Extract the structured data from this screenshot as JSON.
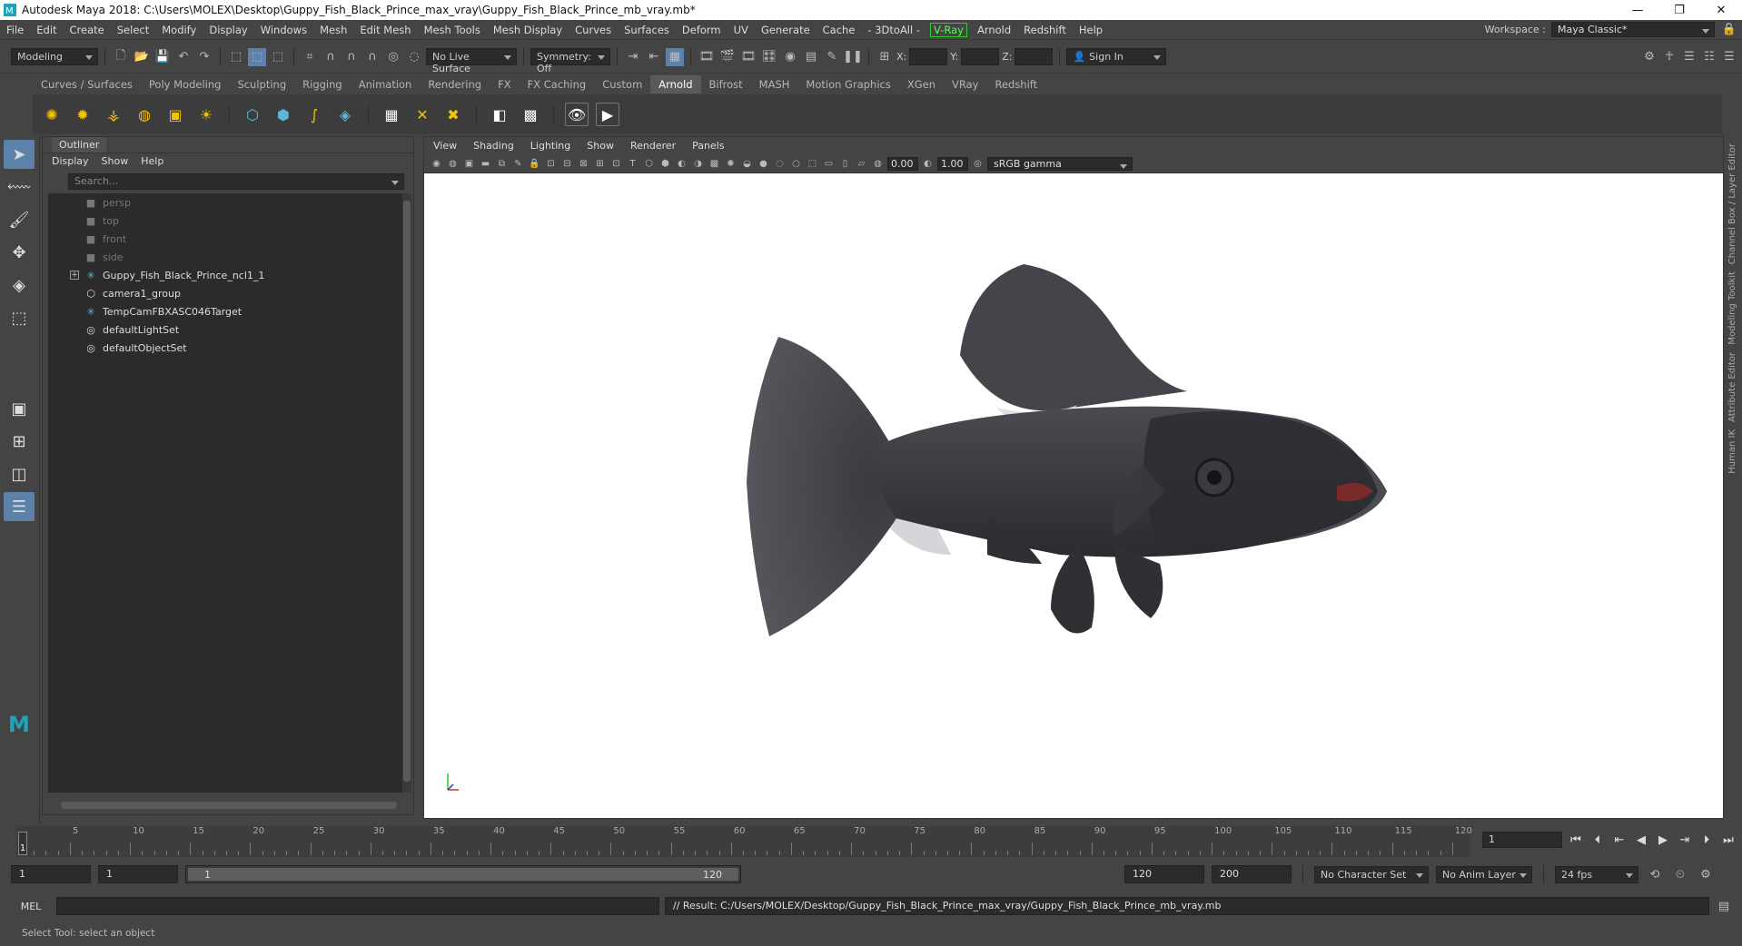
{
  "window": {
    "title": "Autodesk Maya 2018: C:\\Users\\MOLEX\\Desktop\\Guppy_Fish_Black_Prince_max_vray\\Guppy_Fish_Black_Prince_mb_vray.mb*",
    "controls": [
      "—",
      "❐",
      "✕"
    ]
  },
  "menubar": {
    "items": [
      "File",
      "Edit",
      "Create",
      "Select",
      "Modify",
      "Display",
      "Windows",
      "Mesh",
      "Edit Mesh",
      "Mesh Tools",
      "Mesh Display",
      "Curves",
      "Surfaces",
      "Deform",
      "UV",
      "Generate",
      "Cache",
      "- 3DtoAll -"
    ],
    "vray": "V-Ray",
    "items2": [
      "Arnold",
      "Redshift",
      "Help"
    ],
    "workspace_label": "Workspace :",
    "workspace_value": "Maya Classic*"
  },
  "statusline": {
    "mode": "Modeling",
    "live_surface": "No Live Surface",
    "symmetry": "Symmetry: Off",
    "x_label": "X:",
    "y_label": "Y:",
    "z_label": "Z:",
    "sign_in": "Sign In"
  },
  "shelf": {
    "tabs": [
      "Curves / Surfaces",
      "Poly Modeling",
      "Sculpting",
      "Rigging",
      "Animation",
      "Rendering",
      "FX",
      "FX Caching",
      "Custom",
      "Arnold",
      "Bifrost",
      "MASH",
      "Motion Graphics",
      "XGen",
      "VRay",
      "Redshift"
    ],
    "active": "Arnold"
  },
  "outliner": {
    "title": "Outliner",
    "menu": [
      "Display",
      "Show",
      "Help"
    ],
    "search_placeholder": "Search...",
    "items": [
      {
        "label": "persp",
        "type": "camera"
      },
      {
        "label": "top",
        "type": "camera"
      },
      {
        "label": "front",
        "type": "camera"
      },
      {
        "label": "side",
        "type": "camera"
      },
      {
        "label": "Guppy_Fish_Black_Prince_ncl1_1",
        "type": "joint"
      },
      {
        "label": "camera1_group",
        "type": "group"
      },
      {
        "label": "TempCamFBXASC046Target",
        "type": "joint"
      },
      {
        "label": "defaultLightSet",
        "type": "set"
      },
      {
        "label": "defaultObjectSet",
        "type": "set"
      }
    ]
  },
  "viewport": {
    "menu": [
      "View",
      "Shading",
      "Lighting",
      "Show",
      "Renderer",
      "Panels"
    ],
    "exposure": "0.00",
    "gamma": "1.00",
    "color_mode": "sRGB gamma"
  },
  "rightstrip": [
    "Channel Box / Layer Editor",
    "Modeling Toolkit",
    "Attribute Editor",
    "Human IK"
  ],
  "timeline": {
    "ticks": [
      5,
      10,
      15,
      20,
      25,
      30,
      35,
      40,
      45,
      50,
      55,
      60,
      65,
      70,
      75,
      80,
      85,
      90,
      95,
      100,
      105,
      110,
      115,
      120
    ],
    "current_frame": "1",
    "current_field": "1",
    "range_start": "1",
    "range_start2": "1",
    "range_inner_start": "1",
    "range_inner_end": "120",
    "range_end": "120",
    "anim_end": "200",
    "character_set": "No Character Set",
    "anim_layer": "No Anim Layer",
    "fps": "24 fps"
  },
  "cmdline": {
    "label": "MEL",
    "result": "// Result: C:/Users/MOLEX/Desktop/Guppy_Fish_Black_Prince_max_vray/Guppy_Fish_Black_Prince_mb_vray.mb"
  },
  "helpline": "Select Tool: select an object",
  "colors": {
    "accent": "#5d82aa",
    "maya_teal": "#1fa3b8",
    "vray_green": "#33cc33"
  }
}
